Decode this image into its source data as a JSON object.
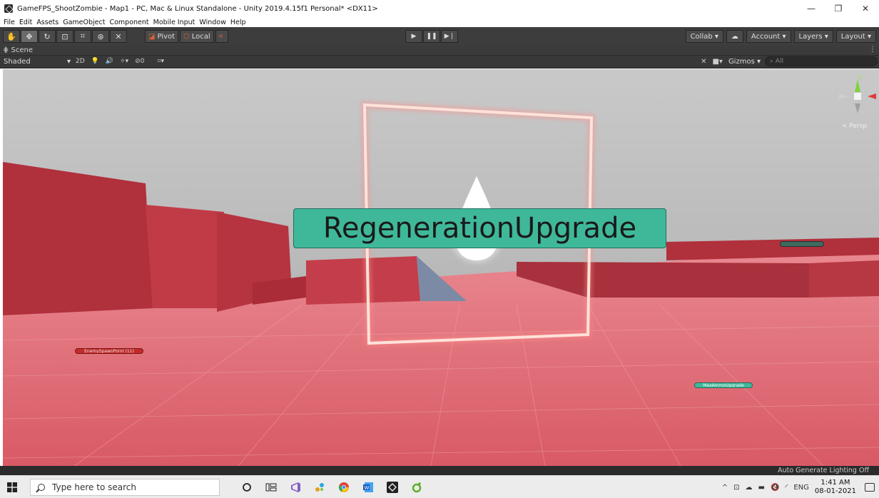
{
  "window": {
    "title": "GameFPS_ShootZombie - Map1 - PC, Mac & Linux Standalone - Unity 2019.4.15f1 Personal* <DX11>",
    "minimize": "—",
    "maximize": "❐",
    "close": "✕"
  },
  "menu": [
    "File",
    "Edit",
    "Assets",
    "GameObject",
    "Component",
    "Mobile Input",
    "Window",
    "Help"
  ],
  "toolbar": {
    "pivot_label": "Pivot",
    "local_label": "Local",
    "collab_label": "Collab ▾",
    "account_label": "Account ▾",
    "layers_label": "Layers ▾",
    "layout_label": "Layout ▾"
  },
  "scene_tab": {
    "label": "⋕ Scene"
  },
  "scene_controls": {
    "draw_mode": "Shaded",
    "mode_2d": "2D",
    "hidden_count": "0",
    "gizmos_label": "Gizmos",
    "search_placeholder": "All"
  },
  "scene": {
    "main_label": "RegenerationUpgrade",
    "enemy_label": "EnemySpawnPoint (11)",
    "ammo_label": "MaxAmmoUpgrade",
    "obj_label": "",
    "persp_label": "< Persp",
    "gizmo_y": "y"
  },
  "status": {
    "text": "Auto Generate Lighting Off"
  },
  "taskbar": {
    "search_placeholder": "Type here to search",
    "lang": "ENG",
    "time": "1:41 AM",
    "date": "08-01-2021"
  },
  "colors": {
    "label_green": "#3fb89a",
    "label_red": "#c42a2a",
    "floor": "#e27078",
    "sky": "#bcbcbc"
  }
}
